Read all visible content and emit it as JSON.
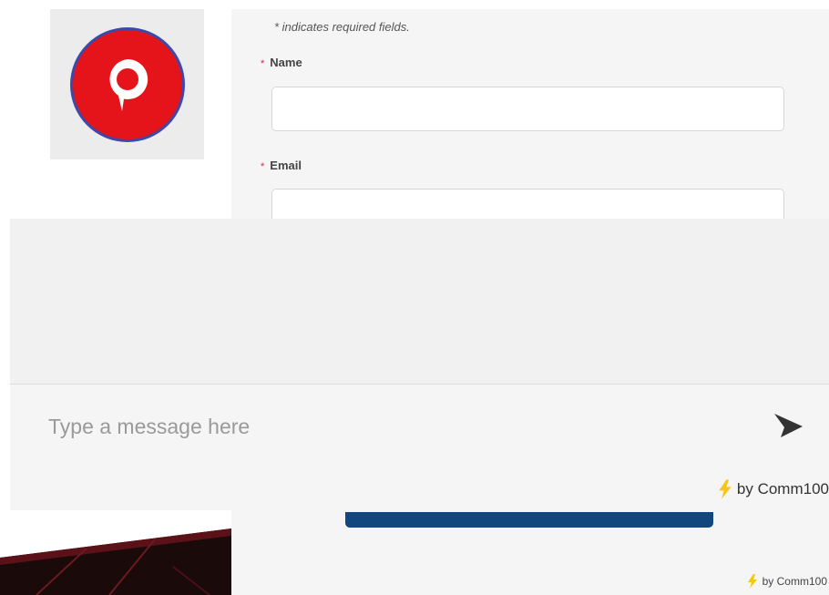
{
  "logo": {
    "icon": "comm100-chat-bubble-icon",
    "brand_color": "#e5141b",
    "ring_color": "#3b4aa8"
  },
  "form": {
    "required_note": "* indicates required fields.",
    "fields": [
      {
        "label": "Name",
        "required_mark": "*",
        "value": ""
      },
      {
        "label": "Email",
        "required_mark": "*",
        "value": ""
      }
    ],
    "submit_color": "#12467e",
    "footer_brand": "by Comm100"
  },
  "chat": {
    "message_placeholder": "Type a message here",
    "send_icon": "send-icon",
    "footer_brand": "by Comm100",
    "bolt_icon": "lightning-bolt-icon"
  }
}
